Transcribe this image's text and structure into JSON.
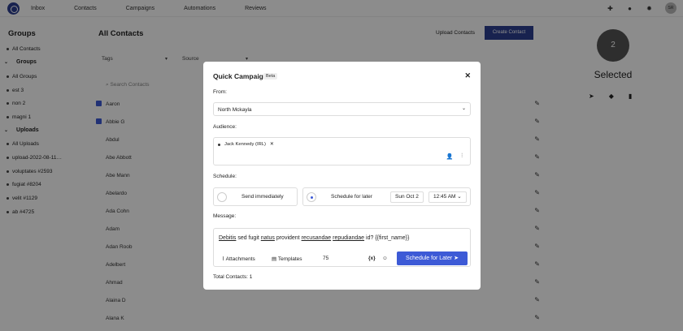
{
  "topnav": {
    "items": [
      "Inbox",
      "Contacts",
      "Campaigns",
      "Automations",
      "Reviews"
    ],
    "user_initials": "SR"
  },
  "sidebar": {
    "title": "Groups",
    "all_contacts": "All Contacts",
    "groups_heading": "Groups",
    "groups": [
      "All Groups",
      "est 3",
      "non 2",
      "magni 1"
    ],
    "uploads_heading": "Uploads",
    "uploads": [
      "All Uploads",
      "upload-2022-08-11…",
      "voluptates #2593",
      "fugiat #8204",
      "velit #1129",
      "ab #4725"
    ]
  },
  "main": {
    "title": "All Contacts",
    "upload_label": "Upload Contacts",
    "create_label": "Create Contact",
    "filters": {
      "tags": "Tags",
      "source": "Source"
    },
    "search_placeholder": "Search Contacts",
    "contacts": [
      "Aaron",
      "Abbie G",
      "Abdul",
      "Abe Abbott",
      "Abe Mann",
      "Abelardo",
      "Ada Cohn",
      "Adam",
      "Adan Roob",
      "Adelbert",
      "Ahmad",
      "Alaina D",
      "Alana K"
    ]
  },
  "right_panel": {
    "count": "2",
    "label": "Selected"
  },
  "modal": {
    "title": "Quick Campaign",
    "badge": "Beta",
    "from_label": "From:",
    "from_value": "North Mckayla",
    "audience_label": "Audience:",
    "audience_chip": "Jack Kennedy (IRL)",
    "schedule_label": "Schedule:",
    "send_now": "Send immediately",
    "schedule_later": "Schedule for later",
    "date": "Sun Oct 2",
    "time": "12:45 AM",
    "message_label": "Message:",
    "message_text_1": "Debitis",
    "message_text_2": " sed fugit ",
    "message_text_3": "natus",
    "message_text_4": " provident ",
    "message_text_5": "recusandae",
    "message_text_6": "repudiandae",
    "message_text_7": " id? {{first_name}}",
    "attachments": "Attachments",
    "templates": "Templates",
    "char_count": "75",
    "var_icon_text": "{x}",
    "submit": "Schedule for Later",
    "total": "Total Contacts: 1"
  }
}
